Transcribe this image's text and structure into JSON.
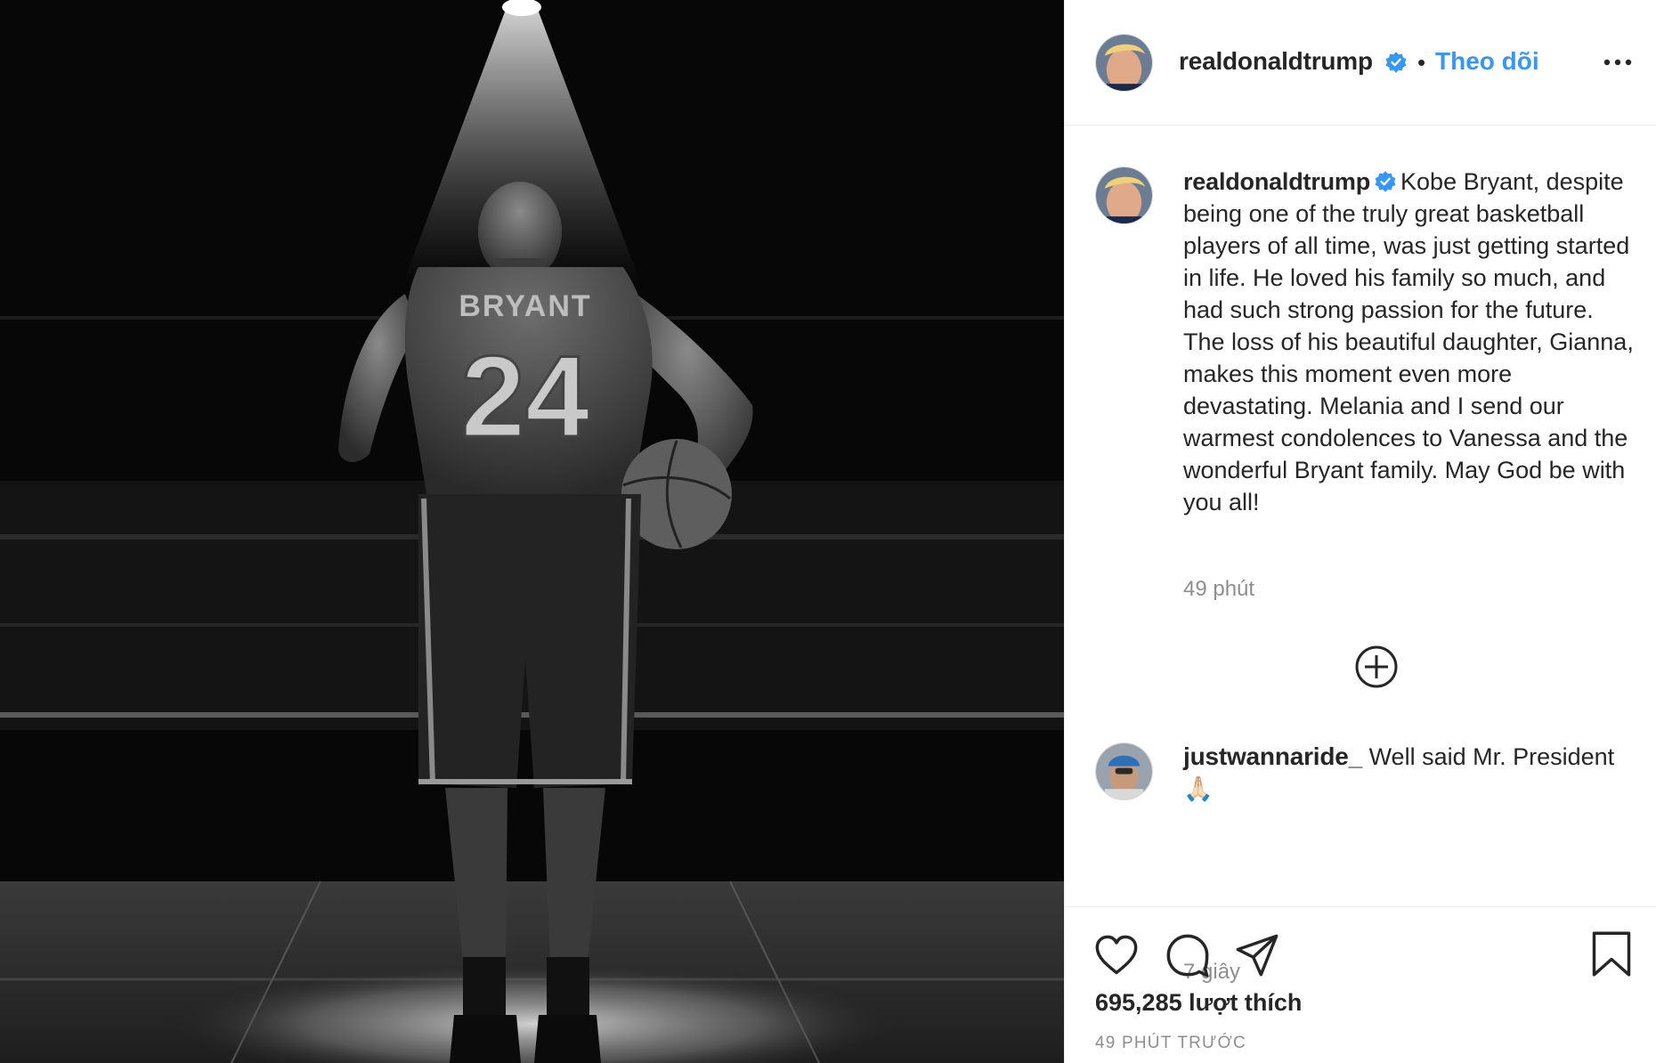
{
  "post": {
    "username": "realdonaldtrump",
    "verified": true,
    "follow_separator": "•",
    "follow_label": "Theo dõi",
    "more_icon": "more-options-icon",
    "photo_jersey_name": "BRYANT",
    "photo_jersey_number": "24"
  },
  "caption": {
    "username": "realdonaldtrump",
    "text": "Kobe Bryant, despite being one of the truly great basketball players of all time, was just getting started in life. He loved his family so much, and had such strong passion for the future. The loss of his beautiful daughter, Gianna, makes this moment even more devastating. Melania and I send our warmest condolences to Vanessa and the wonderful Bryant family. May God be with you all!",
    "time": "49 phút"
  },
  "load_more_icon": "plus-circle-icon",
  "comments": [
    {
      "username": "justwannaride_",
      "text": "Well said Mr. President 🙏🏻",
      "time": "7 giây"
    }
  ],
  "actions": {
    "like_icon": "heart-icon",
    "comment_icon": "comment-icon",
    "share_icon": "send-icon",
    "save_icon": "bookmark-icon",
    "likes_label": "695,285 lượt thích",
    "posted_time": "49 PHÚT TRƯỚC"
  },
  "colors": {
    "link_blue": "#3897f0",
    "verified_blue": "#3897f0",
    "meta_gray": "#8e8e8e",
    "text": "#262626"
  }
}
